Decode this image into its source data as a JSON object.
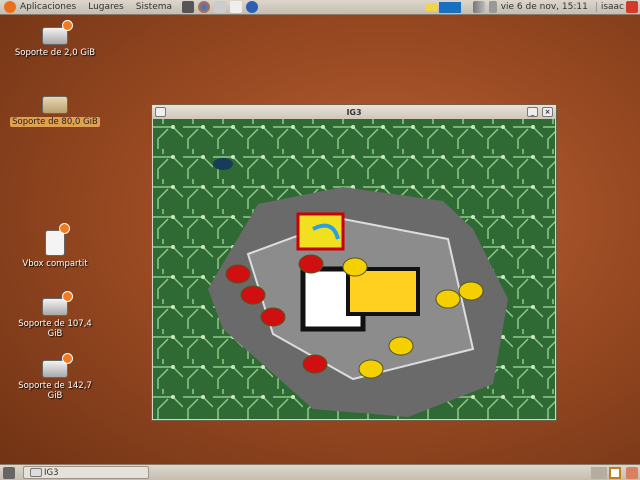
{
  "top_panel": {
    "menus": [
      "Aplicaciones",
      "Lugares",
      "Sistema"
    ],
    "clock": "vie  6 de nov, 15:11",
    "user": "isaac"
  },
  "desktop_icons": [
    {
      "label": "Soporte de 2,0 GiB"
    },
    {
      "label": "Soporte de 80,0 GiB"
    },
    {
      "label": "Vbox compartit"
    },
    {
      "label": "Soporte de 107,4 GiB"
    },
    {
      "label": "Soporte de 142,7 GiB"
    }
  ],
  "window": {
    "title": "IG3",
    "minimize": "_",
    "close": "×"
  },
  "taskbar": {
    "items": [
      {
        "label": "IG3"
      }
    ]
  }
}
